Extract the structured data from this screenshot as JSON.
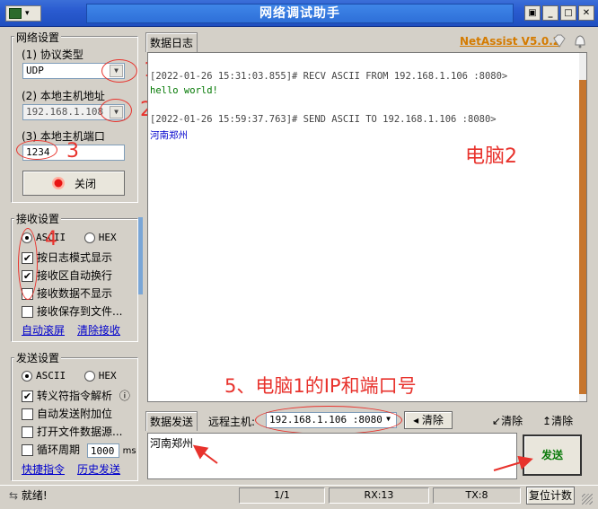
{
  "window": {
    "title": "网络调试助手",
    "menu_caret": "▾",
    "buttons": [
      "▣",
      "_",
      "□",
      "✕"
    ]
  },
  "net_settings": {
    "title": "网络设置",
    "protocol_label": "(1) 协议类型",
    "protocol_value": "UDP",
    "host_label": "(2) 本地主机地址",
    "host_value": "192.168.1.108",
    "port_label": "(3) 本地主机端口",
    "port_value": "1234",
    "close_button": "关闭"
  },
  "recv_settings": {
    "title": "接收设置",
    "ascii": "ASCII",
    "hex": "HEX",
    "log_mode": "按日志模式显示",
    "auto_wrap": "接收区自动换行",
    "hide_data": "接收数据不显示",
    "save_file": "接收保存到文件...",
    "auto_scroll": "自动滚屏",
    "clear_recv": "清除接收"
  },
  "send_settings": {
    "title": "发送设置",
    "ascii": "ASCII",
    "hex": "HEX",
    "escape": "转义符指令解析",
    "info_icon": "ⓘ",
    "auto_append": "自动发送附加位",
    "open_file": "打开文件数据源...",
    "loop": "循环周期",
    "loop_value": "1000",
    "loop_unit": "ms",
    "shortcut": "快捷指令",
    "history": "历史发送"
  },
  "log_panel": {
    "tab": "数据日志",
    "brand": "NetAssist V5.0.2",
    "entries": [
      {
        "header": "[2022-01-26 15:31:03.855]# RECV ASCII FROM 192.168.1.106 :8080>",
        "body": "hello world!"
      },
      {
        "header": "[2022-01-26 15:59:37.763]# SEND ASCII TO 192.168.1.106 :8080>",
        "body": "河南郑州"
      }
    ]
  },
  "send_panel": {
    "tab": "数据发送",
    "remote_label": "远程主机:",
    "remote_value": "192.168.1.106 :8080",
    "clear1": "清除",
    "clear2": "清除",
    "clear3": "清除",
    "content": "河南郑州",
    "send_button": "发送"
  },
  "status": {
    "ready": "就绪!",
    "page": "1/1",
    "rx": "RX:13",
    "tx": "TX:8",
    "reset": "复位计数"
  },
  "annotations": {
    "n1": "1",
    "n2": "2",
    "n3": "3",
    "n4": "4",
    "pc2": "电脑2",
    "step5": "5、电脑1的IP和端口号"
  },
  "colors": {
    "annotation": "#e8322c",
    "recv_text": "#007700",
    "send_text": "#0000cc",
    "brand": "#d47b00"
  }
}
